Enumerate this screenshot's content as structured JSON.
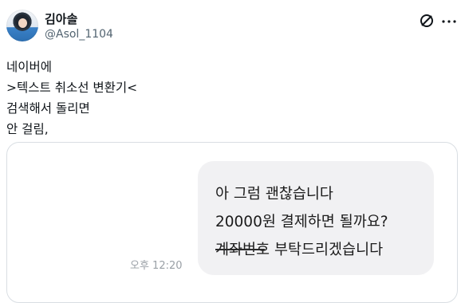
{
  "author": {
    "display_name": "김아솔",
    "handle": "@Asol_1104"
  },
  "icons": {
    "avatar": "profile-photo",
    "grok": "grok-icon",
    "more": "more-dots-icon"
  },
  "post": {
    "lines": [
      "네이버에",
      ">텍스트 취소선 변환기<",
      "검색해서 돌리면",
      "안 걸림,"
    ]
  },
  "media": {
    "bubble_lines": [
      "아 그럼 괜찮습니다",
      "20000원 결제하면 될까요?",
      "계좌번호 부탁드리겠습니다"
    ],
    "timestamp": "오후 12:20"
  },
  "colors": {
    "text": "#0f1419",
    "secondary": "#536471",
    "bubble_bg": "#f1f1f3",
    "card_border": "#d9dee3"
  }
}
